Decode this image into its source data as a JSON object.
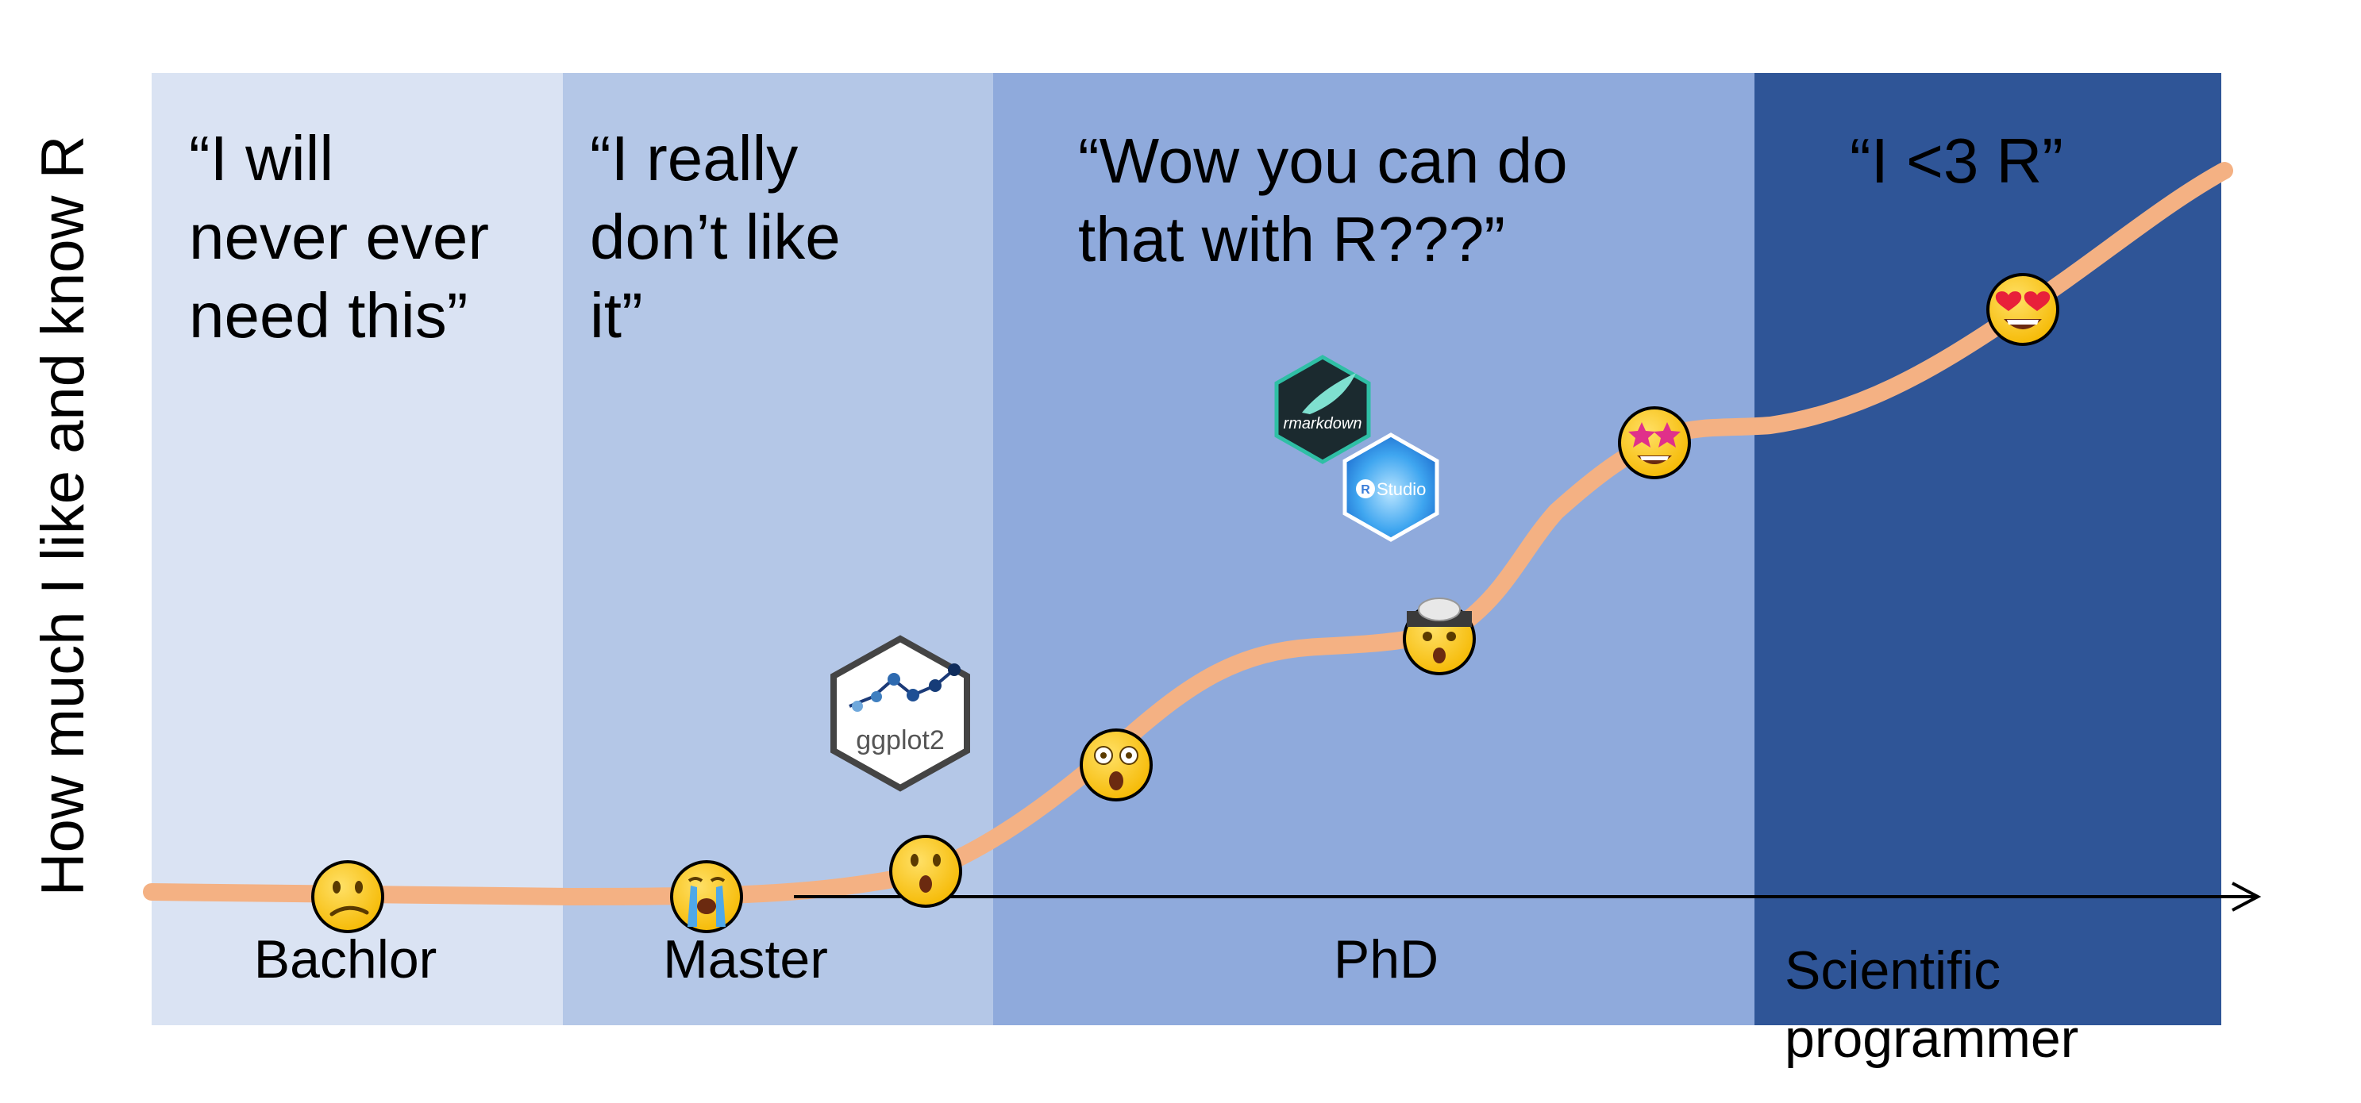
{
  "y_axis_label": "How much I like and know R",
  "phases": [
    {
      "label": "Bachlor",
      "quote": "“I will\nnever ever\nneed this”",
      "color": "#DAE3F3"
    },
    {
      "label": "Master",
      "quote": "“I really\ndon’t like\nit”",
      "color": "#B4C7E7"
    },
    {
      "label": "PhD",
      "quote": "“Wow you can do\nthat with R???”",
      "color": "#8FAADC"
    },
    {
      "label": "Scientific\nprogrammer",
      "quote": "“I <3 R”",
      "color": "#2F5597"
    }
  ],
  "curve_color": "#F4B183",
  "emojis": [
    {
      "name": "confused-face-icon",
      "phase": "Bachlor"
    },
    {
      "name": "crying-face-icon",
      "phase": "Master"
    },
    {
      "name": "surprised-face-icon",
      "phase": "Master"
    },
    {
      "name": "astonished-face-icon",
      "phase": "PhD"
    },
    {
      "name": "mind-blown-face-icon",
      "phase": "PhD"
    },
    {
      "name": "star-struck-face-icon",
      "phase": "PhD"
    },
    {
      "name": "heart-eyes-face-icon",
      "phase": "Scientific programmer"
    }
  ],
  "logos": {
    "ggplot2": "ggplot2",
    "rmarkdown": "rmarkdown",
    "rstudio_r": "R",
    "rstudio_text": "Studio"
  }
}
